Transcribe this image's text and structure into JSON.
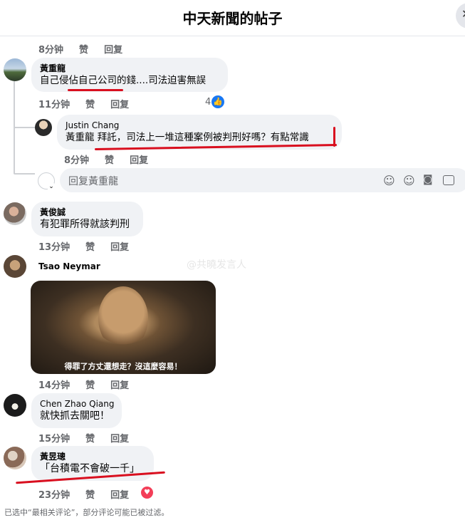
{
  "header": {
    "title": "中天新聞的帖子",
    "close_glyph": "✕"
  },
  "top_meta": {
    "time": "8分钟",
    "like": "赞",
    "reply": "回复"
  },
  "comments": [
    {
      "name": "黃重龍",
      "text": "自己侵佔自己公司的錢....司法迫害無誤",
      "time": "11分钟",
      "like": "赞",
      "reply": "回复",
      "reactions": "4"
    },
    {
      "name": "Justin Chang",
      "text": "黃重龍 拜託，司法上一堆這種案例被判刑好嗎？有點常識",
      "time": "8分钟",
      "like": "赞",
      "reply": "回复"
    },
    {
      "name": "黃俊誠",
      "text": "有犯罪所得就該判刑",
      "time": "13分钟",
      "like": "赞",
      "reply": "回复"
    },
    {
      "name": "Tsao Neymar",
      "image_caption": "得罪了方丈還想走？沒這麼容易！",
      "time": "14分钟",
      "like": "赞",
      "reply": "回复"
    },
    {
      "name": "Chen Zhao Qiang",
      "text": "就快抓去關吧！",
      "time": "15分钟",
      "like": "赞",
      "reply": "回复"
    },
    {
      "name": "黃昱璁",
      "text": "「台積電不會破一千」",
      "time": "23分钟",
      "like": "赞",
      "reply": "回复"
    }
  ],
  "reply_box": {
    "placeholder": "回复黃重龍"
  },
  "watermark": "@共曉发言人",
  "footer": "已选中“最相关评论”，部分评论可能已被过滤。",
  "colors": {
    "accent": "#1877f2",
    "red_mark": "#d90f1f",
    "heart": "#f33e58"
  }
}
